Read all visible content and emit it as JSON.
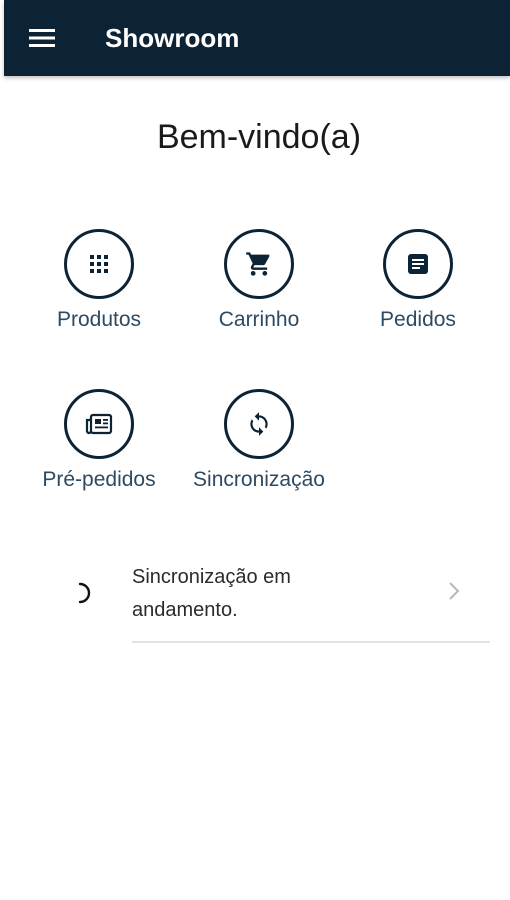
{
  "appbar": {
    "title": "Showroom",
    "menu_icon": "menu-icon"
  },
  "welcome": "Bem-vindo(a)",
  "tiles": [
    {
      "label": "Produtos",
      "icon": "grid-icon"
    },
    {
      "label": "Carrinho",
      "icon": "cart-icon"
    },
    {
      "label": "Pedidos",
      "icon": "list-box-icon"
    },
    {
      "label": "Pré-pedidos",
      "icon": "newspaper-icon"
    },
    {
      "label": "Sincronização",
      "icon": "sync-icon"
    }
  ],
  "sync_status": {
    "text": "Sincronização em andamento."
  },
  "colors": {
    "appbar": "#0b2335",
    "accent": "#0b2335",
    "label": "#2e4a62"
  }
}
